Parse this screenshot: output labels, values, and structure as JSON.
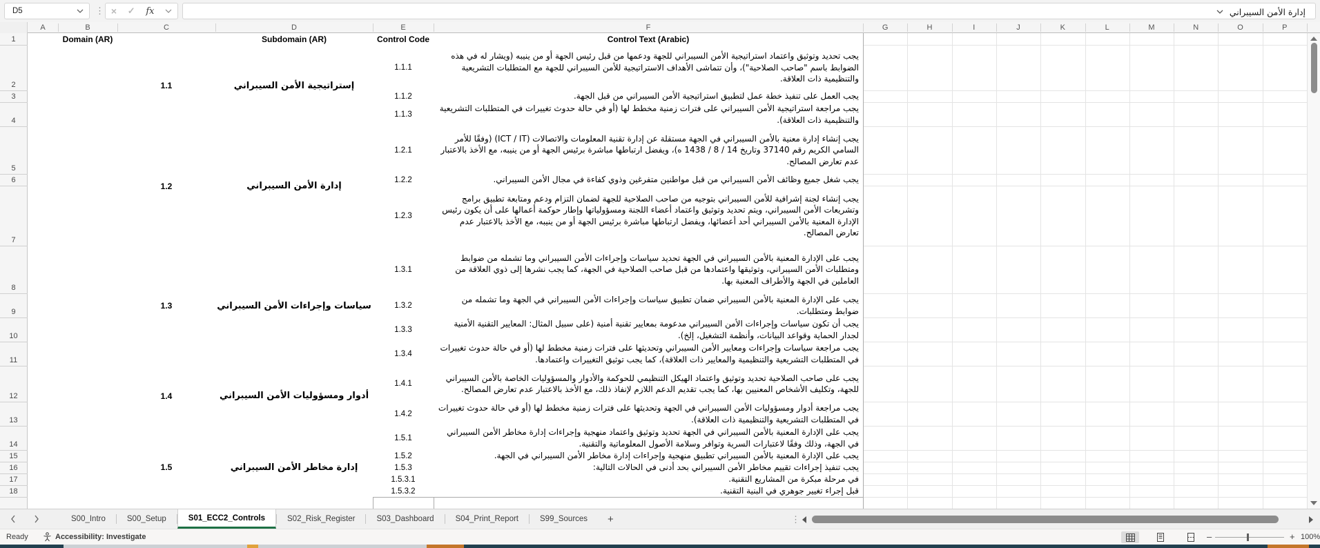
{
  "formula_bar": {
    "name_box": "D5",
    "value": "إدارة الأمن السيبراني"
  },
  "icons": {
    "close": "×",
    "check": "✓",
    "function": "fx",
    "more_vertical": "⋮",
    "zoom_out": "–",
    "zoom_in": "+"
  },
  "columns": [
    "A",
    "B",
    "C",
    "D",
    "E",
    "F",
    "G",
    "H",
    "I",
    "J",
    "K",
    "L",
    "M",
    "N",
    "O",
    "P"
  ],
  "row_numbers": [
    1,
    2,
    3,
    4,
    5,
    6,
    7,
    8,
    9,
    10,
    11,
    12,
    13,
    14,
    15,
    16,
    17,
    18
  ],
  "table": {
    "headers": {
      "domain": "Domain (AR)",
      "subdomain": "Subdomain (AR)",
      "control_code": "Control Code",
      "control_text": "Control Text (Arabic)"
    },
    "groups": [
      {
        "code": "1.1",
        "subdomain_ar": "إستراتيجية الأمن السيبراني",
        "controls": [
          {
            "code": "1.1.1",
            "text": "يجب تحديد وتوثيق واعتماد استراتيجية الأمن السيبراني للجهة ودعمها من قبل رئيس الجهة أو من ينيبه (ويشار له في هذه الضوابط باسم \"صاحب الصلاحية\")، وأن تتماشى الأهداف الاستراتيجية للأمن السيبراني للجهة مع المتطلبات التشريعية والتنظيمية ذات العلاقة."
          },
          {
            "code": "1.1.2",
            "text": "يجب العمل على تنفيذ خطة عمل لتطبيق استراتيجية الأمن السيبراني من قبل الجهة."
          },
          {
            "code": "1.1.3",
            "text": "يجب مراجعة استراتيجية الأمن السيبراني على فترات زمنية مخطط لها (أو في حالة حدوث تغييرات في المتطلبات التشريعية والتنظيمية ذات العلاقة)."
          }
        ]
      },
      {
        "code": "1.2",
        "subdomain_ar": "إدارة الأمن السيبراني",
        "controls": [
          {
            "code": "1.2.1",
            "text": "يجب إنشاء إدارة معنية بالأمن السيبراني في الجهة مستقلة عن إدارة تقنية المعلومات والاتصالات (ICT / IT) (وفقًا للأمر السامي الكريم رقم 37140 وتاريخ 14 / 8 / 1438 ه)، ويفضل ارتباطها مباشرة برئيس الجهة أو من ينيبه، مع الأخذ بالاعتبار عدم تعارض المصالح."
          },
          {
            "code": "1.2.2",
            "text": "يجب شغل جميع وظائف الأمن السيبراني من قبل مواطنين متفرغين وذوي كفاءة في مجال الأمن السيبراني."
          },
          {
            "code": "1.2.3",
            "text": "يجب إنشاء لجنة إشرافية للأمن السيبراني بتوجيه من صاحب الصلاحية للجهة لضمان التزام ودعم ومتابعة تطبيق برامج وتشريعات الأمن السيبراني، ويتم تحديد وتوثيق واعتماد أعضاء اللجنة ومسؤولياتها وإطار حوكمة أعمالها على أن يكون رئيس الإدارة المعنية بالأمن السيبراني أحد أعضائها، ويفضل ارتباطها مباشرة برئيس الجهة أو من ينيبه، مع الأخذ بالاعتبار عدم تعارض المصالح."
          }
        ]
      },
      {
        "code": "1.3",
        "subdomain_ar": "سياسات وإجراءات الأمن السيبراني",
        "controls": [
          {
            "code": "1.3.1",
            "text": "يجب على الإدارة المعنية بالأمن السيبراني في الجهة تحديد سياسات وإجراءات الأمن السيبراني وما تشمله من ضوابط ومتطلبات الأمن السيبراني، وتوثيقها واعتمادها من قبل صاحب الصلاحية في الجهة، كما يجب نشرها إلى ذوي العلاقة من العاملين في الجهة والأطراف المعنية بها."
          },
          {
            "code": "1.3.2",
            "text": "يجب على الإدارة المعنية بالأمن السيبراني ضمان تطبيق سياسات وإجراءات الأمن السيبراني في الجهة وما تشمله من ضوابط ومتطلبات."
          },
          {
            "code": "1.3.3",
            "text": "يجب أن تكون سياسات وإجراءات الأمن السيبراني مدعومة بمعايير تقنية أمنية (على سبيل المثال: المعايير التقنية الأمنية لجدار الحماية وقواعد البيانات، وأنظمة التشغيل، إلخ)."
          },
          {
            "code": "1.3.4",
            "text": "يجب مراجعة سياسات وإجراءات ومعايير الأمن السيبراني وتحديثها على فترات زمنية مخطط لها (أو في حالة حدوث تغييرات في المتطلبات التشريعية والتنظيمية والمعايير ذات العلاقة)، كما يجب توثيق التغييرات واعتمادها."
          }
        ]
      },
      {
        "code": "1.4",
        "subdomain_ar": "أدوار ومسؤوليات الأمن السيبراني",
        "controls": [
          {
            "code": "1.4.1",
            "text": "يجب على صاحب الصلاحية تحديد وتوثيق واعتماد الهيكل التنظيمي للحوكمة والأدوار والمسؤوليات الخاصة بالأمن السيبراني للجهة، وتكليف الأشخاص المعنيين بها، كما يجب تقديم الدعم اللازم لإنفاذ ذلك، مع الأخذ بالاعتبار عدم تعارض المصالح."
          },
          {
            "code": "1.4.2",
            "text": "يجب مراجعة أدوار ومسؤوليات الأمن السيبراني في الجهة وتحديثها على فترات زمنية مخطط لها (أو في حالة حدوث تغييرات في المتطلبات التشريعية والتنظيمية ذات العلاقة)."
          }
        ]
      },
      {
        "code": "1.5",
        "subdomain_ar": "إدارة مخاطر الأمن السيبراني",
        "controls": [
          {
            "code": "1.5.1",
            "text": "يجب على الإدارة المعنية بالأمن السيبراني في الجهة تحديد وتوثيق واعتماد منهجية وإجراءات إدارة مخاطر الأمن السيبراني في الجهة، وذلك وفقًا لاعتبارات السرية وتوافر وسلامة الأصول المعلوماتية والتقنية."
          },
          {
            "code": "1.5.2",
            "text": "يجب على الإدارة المعنية بالأمن السيبراني تطبيق منهجية وإجراءات إدارة مخاطر الأمن السيبراني في الجهة."
          },
          {
            "code": "1.5.3",
            "text": "يجب تنفيذ إجراءات تقييم مخاطر الأمن السيبراني بحد أدنى في الحالات التالية:"
          },
          {
            "code": "1.5.3.1",
            "text": "في مرحلة مبكرة من المشاريع التقنية."
          },
          {
            "code": "1.5.3.2",
            "text": "قبل إجراء تغيير جوهري في البنية التقنية."
          }
        ]
      }
    ]
  },
  "sheet_tabs": {
    "tabs": [
      "S00_Intro",
      "S00_Setup",
      "S01_ECC2_Controls",
      "S02_Risk_Register",
      "S03_Dashboard",
      "S04_Print_Report",
      "S99_Sources"
    ],
    "active": "S01_ECC2_Controls",
    "add_label": "+"
  },
  "status_bar": {
    "ready": "Ready",
    "accessibility": "Accessibility: Investigate",
    "zoom_level": "100%"
  },
  "colors": {
    "tab_accent": "#1e7145",
    "taskbar": "#22404f",
    "taskbar_orange": "#c4762a"
  }
}
